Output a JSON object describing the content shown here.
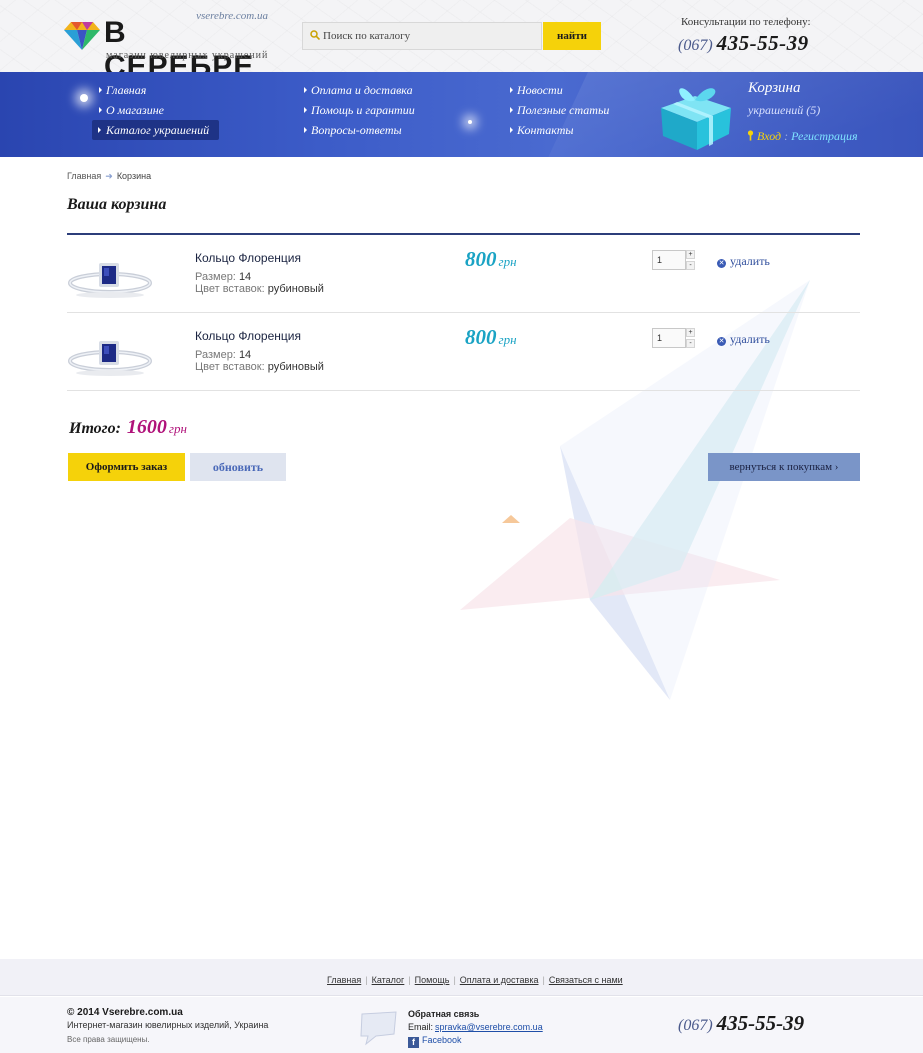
{
  "header": {
    "domain": "vserebre.com.ua",
    "logo_name": "В СЕРЕБРЕ",
    "tagline": "магазин ювелирных украшений",
    "search_placeholder": "Поиск по каталогу",
    "search_button": "найти",
    "phone_label": "Консультации по телефону:",
    "phone_code": "(067)",
    "phone_number": "435-55-39"
  },
  "nav": {
    "col1": [
      "Главная",
      "О магазине",
      "Каталог украшений"
    ],
    "col2": [
      "Оплата и доставка",
      "Помощь и гарантии",
      "Вопросы-ответы"
    ],
    "col3": [
      "Новости",
      "Полезные статьи",
      "Контакты"
    ],
    "active_item": "Каталог украшений"
  },
  "cart_widget": {
    "title": "Корзина",
    "count_text": "украшений (5)",
    "login": "Вход",
    "separator": ":",
    "register": "Регистрация"
  },
  "breadcrumb": {
    "home": "Главная",
    "current": "Корзина"
  },
  "page_title": "Ваша корзина",
  "cart_items": [
    {
      "name": "Кольцо Флоренция",
      "size_label": "Размер:",
      "size": "14",
      "insert_label": "Цвет вставок:",
      "insert": "рубиновый",
      "price": "800",
      "currency": "грн",
      "qty": "1",
      "delete_label": "удалить"
    },
    {
      "name": "Кольцо Флоренция",
      "size_label": "Размер:",
      "size": "14",
      "insert_label": "Цвет вставок:",
      "insert": "рубиновый",
      "price": "800",
      "currency": "грн",
      "qty": "1",
      "delete_label": "удалить"
    }
  ],
  "total": {
    "label": "Итого:",
    "value": "1600",
    "currency": "грн"
  },
  "buttons": {
    "order": "Оформить заказ",
    "update": "обновить",
    "back": "вернуться к покупкам ›"
  },
  "footer": {
    "links": [
      "Главная",
      "Каталог",
      "Помощь",
      "Оплата и доставка",
      "Связаться с нами"
    ],
    "copyright": "© 2014 Vserebre.com.ua",
    "subtitle": "Интернет-магазин ювелирных изделий, Украина",
    "rights": "Все права защищены.",
    "feedback_title": "Обратная связь",
    "email_label": "Email:",
    "email": "spravka@vserebre.com.ua",
    "facebook": "Facebook",
    "phone_code": "(067)",
    "phone_number": "435-55-39"
  },
  "colors": {
    "brand_blue": "#3c5cc8",
    "accent_yellow": "#f5d20a",
    "price_cyan": "#1aa3c4",
    "total_magenta": "#b0127a"
  }
}
